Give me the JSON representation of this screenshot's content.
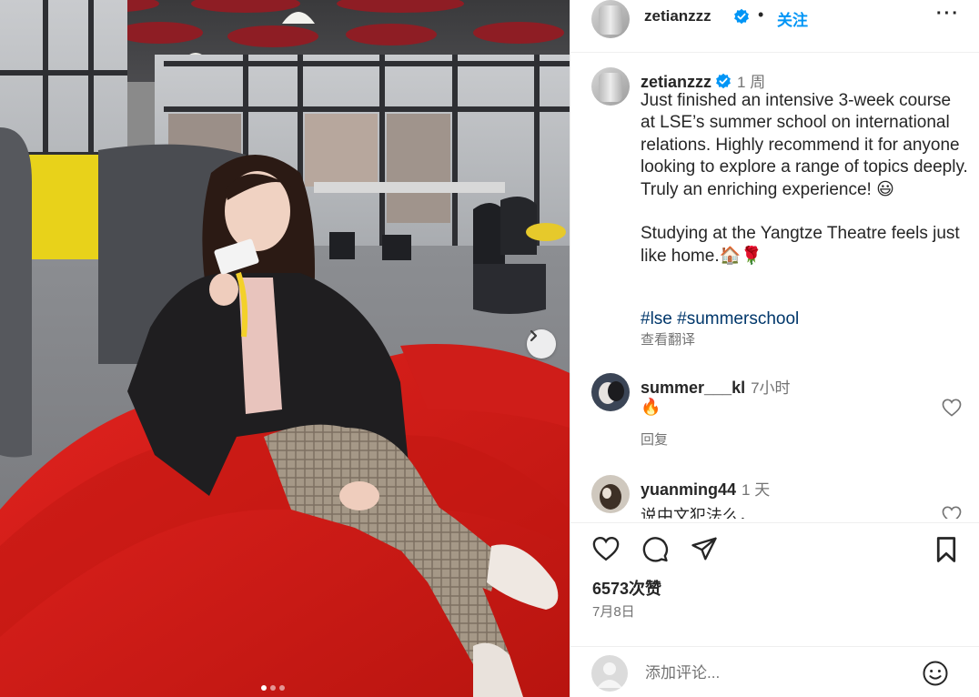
{
  "post": {
    "author": "zetianzzz",
    "header_separator": "•",
    "follow_label": "关注",
    "more_label": "···",
    "caption": {
      "username": "zetianzzz",
      "time": "1 周",
      "text": "Just finished an intensive 3-week course at LSE’s summer school on international relations. Highly recommend it for anyone looking to explore a range of topics deeply. Truly an enriching experience! 😃\n\nStudying at the Yangtze Theatre feels just like home.🏠🌹",
      "hashtags": "#lse #summerschool",
      "translate_label": "查看翻译"
    },
    "comments": [
      {
        "username": "summer___kl",
        "time": "7小时",
        "text": "🔥",
        "reply_label": "回复"
      },
      {
        "username": "yuanming44",
        "time": "1 天",
        "text": "说中文犯法么，"
      }
    ],
    "likes": "6573次赞",
    "date": "7月8日",
    "comment_placeholder": "添加评论...",
    "carousel": {
      "total": 3,
      "active": 1
    }
  },
  "icons": {
    "verified": "verified-badge-icon",
    "like": "heart-icon",
    "comment": "comment-icon",
    "share": "send-icon",
    "save": "bookmark-icon",
    "emoji": "smiley-icon",
    "next": "chevron-right-icon"
  },
  "colors": {
    "link_blue": "#0095f6",
    "hashtag": "#00376b",
    "secondary_text": "#737373",
    "verified": "#0095f6"
  }
}
